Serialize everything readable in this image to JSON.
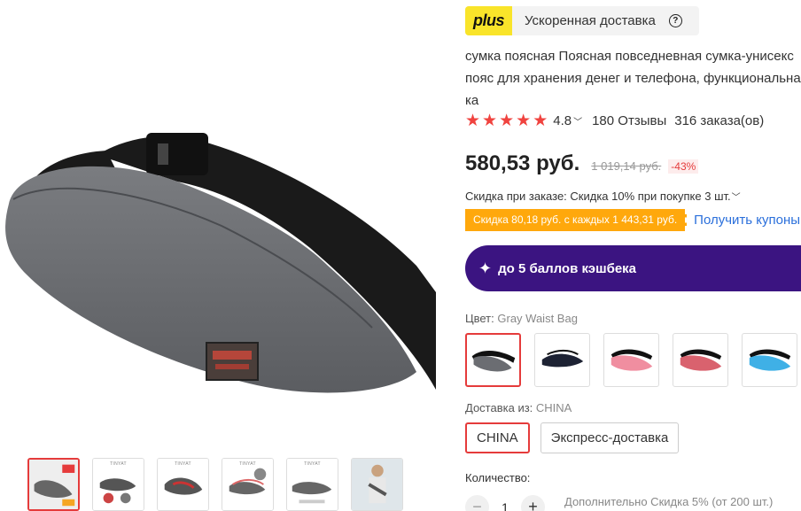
{
  "delivery_banner": {
    "logo_text": "plus",
    "text": "Ускоренная доставка",
    "help_icon": "question-circle-icon"
  },
  "product": {
    "title": "сумка поясная Поясная повседневная сумка-унисекс пояс для хранения денег и телефона, функциональная ка"
  },
  "rating": {
    "stars": 5,
    "value": "4.8",
    "reviews": "180 Отзывы",
    "orders": "316 заказа(ов)"
  },
  "price": {
    "current": "580,53 руб.",
    "old": "1 019,14 руб.",
    "discount": "-43%"
  },
  "order_discount": {
    "text": "Скидка при заказе: Скидка 10% при покупке 3 шт."
  },
  "coupon": {
    "tag": "Скидка 80,18 руб. с каждых 1 443,31 руб.",
    "link": "Получить купоны"
  },
  "cashback": {
    "text": "до 5 баллов кэшбека"
  },
  "color": {
    "label": "Цвет:",
    "selected": "Gray Waist Bag",
    "options": [
      "gray",
      "navy",
      "pink",
      "rose",
      "sky-blue"
    ],
    "option_colors": [
      "#6b6d72",
      "#1d2233",
      "#f08ea0",
      "#d9626e",
      "#3fb0e6"
    ]
  },
  "shipping": {
    "label": "Доставка из:",
    "selected": "CHINA",
    "options": [
      "CHINA",
      "Экспресс-доставка"
    ]
  },
  "quantity": {
    "label": "Количество:",
    "value": "1",
    "minus": "−",
    "plus": "+",
    "note": "Дополнительно Скидка 5% (от 200 шт.)"
  },
  "gallery": {
    "thumb_labels": [
      "",
      "TINYAT",
      "TINYAT",
      "TINYAT",
      "TINYAT",
      ""
    ],
    "active_index": 0
  }
}
